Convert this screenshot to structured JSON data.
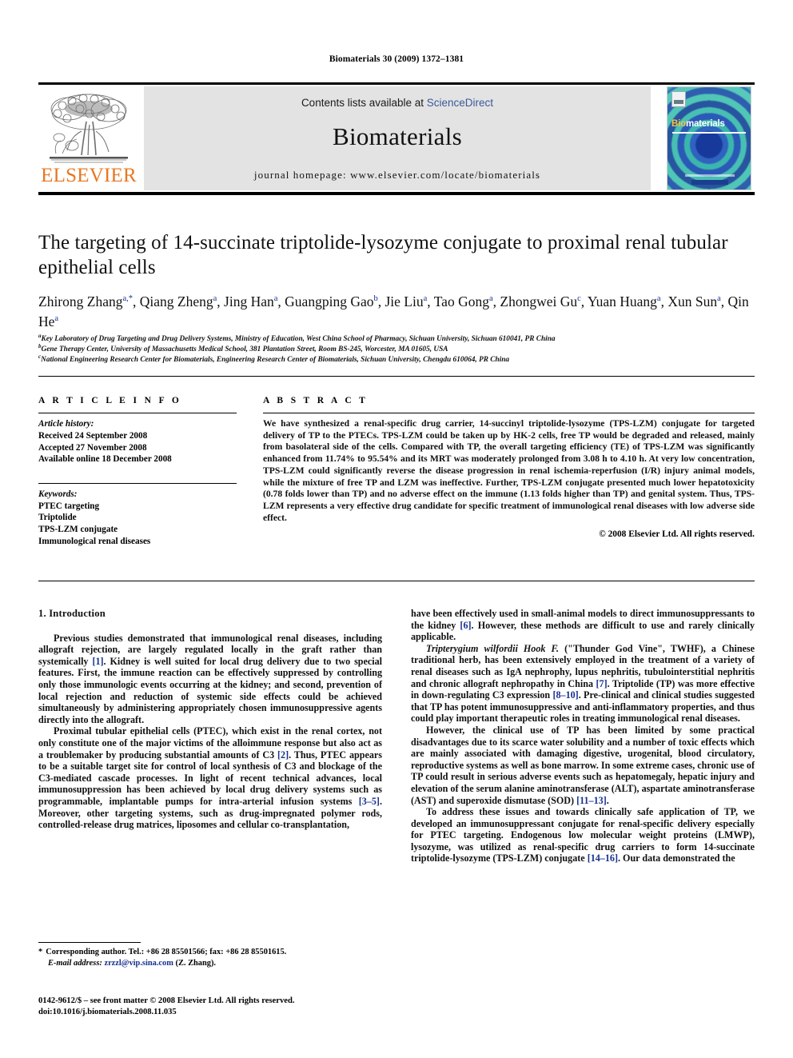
{
  "running_head": "Biomaterials 30 (2009) 1372–1381",
  "masthead": {
    "publisher_name": "ELSEVIER",
    "contents_prefix": "Contents lists available at ",
    "contents_link": "ScienceDirect",
    "journal_name": "Biomaterials",
    "homepage": "journal homepage: www.elsevier.com/locate/biomaterials",
    "cover_title_part1": "Bio",
    "cover_title_part2": "materials",
    "link_color": "#3b5998",
    "elsevier_orange": "#E87722",
    "cover_teal": "#3bb6ad"
  },
  "article": {
    "title": "The targeting of 14-succinate triptolide-lysozyme conjugate to proximal renal tubular epithelial cells",
    "authors": [
      {
        "name": "Zhirong Zhang",
        "sup": "a,*"
      },
      {
        "name": "Qiang Zheng",
        "sup": "a"
      },
      {
        "name": "Jing Han",
        "sup": "a"
      },
      {
        "name": "Guangping Gao",
        "sup": "b"
      },
      {
        "name": "Jie Liu",
        "sup": "a"
      },
      {
        "name": "Tao Gong",
        "sup": "a"
      },
      {
        "name": "Zhongwei Gu",
        "sup": "c"
      },
      {
        "name": "Yuan Huang",
        "sup": "a"
      },
      {
        "name": "Xun Sun",
        "sup": "a"
      },
      {
        "name": "Qin He",
        "sup": "a"
      }
    ],
    "affiliations": [
      {
        "marker": "a",
        "text": "Key Laboratory of Drug Targeting and Drug Delivery Systems, Ministry of Education, West China School of Pharmacy, Sichuan University, Sichuan 610041, PR China"
      },
      {
        "marker": "b",
        "text": "Gene Therapy Center, University of Massachusetts Medical School, 381 Plantation Street, Room BS-245, Worcester, MA 01605, USA"
      },
      {
        "marker": "c",
        "text": "National Engineering Research Center for Biomaterials, Engineering Research Center of Biomaterials, Sichuan University, Chengdu 610064, PR China"
      }
    ]
  },
  "article_info": {
    "heading": "A R T I C L E   I N F O",
    "history_label": "Article history:",
    "history": [
      "Received 24 September 2008",
      "Accepted 27 November 2008",
      "Available online 18 December 2008"
    ],
    "keywords_label": "Keywords:",
    "keywords": [
      "PTEC targeting",
      "Triptolide",
      "TPS-LZM conjugate",
      "Immunological renal diseases"
    ]
  },
  "abstract": {
    "heading": "A B S T R A C T",
    "text": "We have synthesized a renal-specific drug carrier, 14-succinyl triptolide-lysozyme (TPS-LZM) conjugate for targeted delivery of TP to the PTECs. TPS-LZM could be taken up by HK-2 cells, free TP would be degraded and released, mainly from basolateral side of the cells. Compared with TP, the overall targeting efficiency (TE) of TPS-LZM was significantly enhanced from 11.74% to 95.54% and its MRT was moderately prolonged from 3.08 h to 4.10 h. At very low concentration, TPS-LZM could significantly reverse the disease progression in renal ischemia-reperfusion (I/R) injury animal models, while the mixture of free TP and LZM was ineffective. Further, TPS-LZM conjugate presented much lower hepatotoxicity (0.78 folds lower than TP) and no adverse effect on the immune (1.13 folds higher than TP) and genital system. Thus, TPS-LZM represents a very effective drug candidate for specific treatment of immunological renal diseases with low adverse side effect.",
    "copyright": "© 2008 Elsevier Ltd. All rights reserved."
  },
  "body": {
    "section_heading": "1. Introduction",
    "left_paragraphs": [
      "Previous studies demonstrated that immunological renal diseases, including allograft rejection, are largely regulated locally in the graft rather than systemically [1]. Kidney is well suited for local drug delivery due to two special features. First, the immune reaction can be effectively suppressed by controlling only those immunologic events occurring at the kidney; and second, prevention of local rejection and reduction of systemic side effects could be achieved simultaneously by administering appropriately chosen immunosuppressive agents directly into the allograft.",
      "Proximal tubular epithelial cells (PTEC), which exist in the renal cortex, not only constitute one of the major victims of the alloimmune response but also act as a troublemaker by producing substantial amounts of C3 [2]. Thus, PTEC appears to be a suitable target site for control of local synthesis of C3 and blockage of the C3-mediated cascade processes. In light of recent technical advances, local immunosuppression has been achieved by local drug delivery systems such as programmable, implantable pumps for intra-arterial infusion systems [3–5]. Moreover, other targeting systems, such as drug-impregnated polymer rods, controlled-release drug matrices, liposomes and cellular co-transplantation,"
    ],
    "right_paragraphs": [
      "have been effectively used in small-animal models to direct immunosuppressants to the kidney [6]. However, these methods are difficult to use and rarely clinically applicable.",
      "Tripterygium wilfordii Hook F. (\"Thunder God Vine\", TWHF), a Chinese traditional herb, has been extensively employed in the treatment of a variety of renal diseases such as IgA nephrophy, lupus nephritis, tubulointerstitial nephritis and chronic allograft nephropathy in China [7]. Triptolide (TP) was more effective in down-regulating C3 expression [8–10]. Pre-clinical and clinical studies suggested that TP has potent immunosuppressive and anti-inflammatory properties, and thus could play important therapeutic roles in treating immunological renal diseases.",
      "However, the clinical use of TP has been limited by some practical disadvantages due to its scarce water solubility and a number of toxic effects which are mainly associated with damaging digestive, urogenital, blood circulatory, reproductive systems as well as bone marrow. In some extreme cases, chronic use of TP could result in serious adverse events such as hepatomegaly, hepatic injury and elevation of the serum alanine aminotransferase (ALT), aspartate aminotransferase (AST) and superoxide dismutase (SOD) [11–13].",
      "To address these issues and towards clinically safe application of TP, we developed an immunosuppressant conjugate for renal-specific delivery especially for PTEC targeting. Endogenous low molecular weight proteins (LMWP), lysozyme, was utilized as renal-specific drug carriers to form 14-succinate triptolide-lysozyme (TPS-LZM) conjugate [14–16]. Our data demonstrated the"
    ]
  },
  "footnote": {
    "marker": "*",
    "corresponding": "Corresponding author. Tel.: +86 28 85501566; fax: +86 28 85501615.",
    "email_label": "E-mail address:",
    "email": "zrzzl@vip.sina.com",
    "email_suffix": "(Z. Zhang)."
  },
  "footer": {
    "line1": "0142-9612/$ – see front matter © 2008 Elsevier Ltd. All rights reserved.",
    "line2": "doi:10.1016/j.biomaterials.2008.11.035"
  }
}
